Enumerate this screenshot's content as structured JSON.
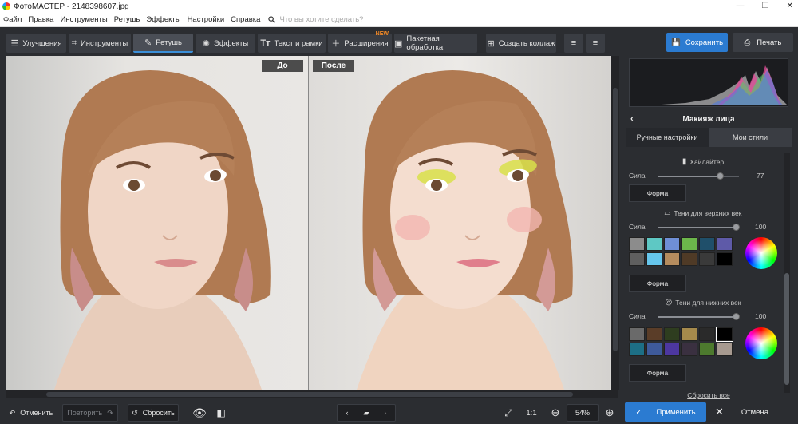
{
  "window": {
    "title": "ФотоМАСТЕР - 2148398607.jpg",
    "min": "—",
    "max": "❐",
    "close": "✕"
  },
  "menu": {
    "items": [
      "Файл",
      "Правка",
      "Инструменты",
      "Ретушь",
      "Эффекты",
      "Настройки",
      "Справка"
    ],
    "search_placeholder": "Что вы хотите сделать?"
  },
  "toolbar": {
    "tabs": [
      {
        "label": "Улучшения",
        "icon": "sliders-icon"
      },
      {
        "label": "Инструменты",
        "icon": "crop-icon"
      },
      {
        "label": "Ретушь",
        "icon": "brush-icon",
        "active": true
      },
      {
        "label": "Эффекты",
        "icon": "sparkle-icon"
      },
      {
        "label": "Текст и рамки",
        "icon": "text-icon"
      },
      {
        "label": "Расширения",
        "icon": "plus-icon",
        "badge": "NEW"
      },
      {
        "label": "Пакетная обработка",
        "icon": "image-stack-icon"
      },
      {
        "label": "Создать коллаж",
        "icon": "collage-icon"
      }
    ],
    "save_label": "Сохранить",
    "print_label": "Печать"
  },
  "canvas": {
    "before_label": "До",
    "after_label": "После"
  },
  "panel": {
    "title": "Макияж лица",
    "tabs": [
      "Ручные настройки",
      "Мои стили"
    ],
    "highlighter": {
      "title": "Хайлайтер",
      "strength_label": "Сила",
      "strength": 77,
      "shape_label": "Форма"
    },
    "upper_lids": {
      "title": "Тени для верхних век",
      "strength_label": "Сила",
      "strength": 100,
      "shape_label": "Форма",
      "colors": [
        "#8c8c8c",
        "#5ec8c4",
        "#6f8fd6",
        "#6cb74b",
        "#1f4f6a",
        "#5e5aa8",
        "#5f5f5f",
        "#66c6ec",
        "#b58c5e",
        "#4f3a26",
        "#3a3a3a",
        "#000000"
      ]
    },
    "lower_lids": {
      "title": "Тени для нижних век",
      "strength_label": "Сила",
      "strength": 100,
      "shape_label": "Форма",
      "colors": [
        "#6a6a6a",
        "#5a3d28",
        "#2e3d1f",
        "#a58a4c",
        "#2a2a2a",
        "#000000",
        "#1d6f86",
        "#3e5a9a",
        "#4d37a0",
        "#3a3040",
        "#4d7a2e",
        "#a79a90"
      ]
    },
    "reset_all": "Сбросить все"
  },
  "bottom": {
    "undo_label": "Отменить",
    "redo_label": "Повторить",
    "reset_label": "Сбросить",
    "ratio_label": "1:1",
    "zoom_value": "54%",
    "apply_label": "Применить",
    "cancel_label": "Отмена"
  },
  "colors": {
    "accent": "#2b7bd1",
    "background": "#2b2d31",
    "badge": "#f28a28"
  }
}
